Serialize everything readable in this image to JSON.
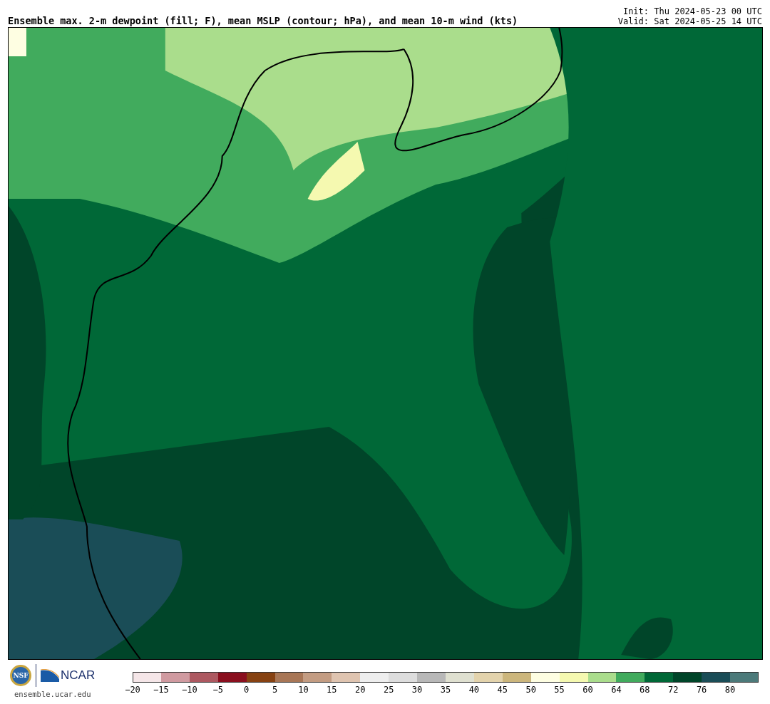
{
  "title": "Ensemble max. 2-m dewpoint (fill; F), mean MSLP (contour; hPa), and mean 10-m wind (kts)",
  "init": "Init: Thu 2024-05-23 00 UTC",
  "valid": "Valid: Sat 2024-05-25 14 UTC",
  "logos": {
    "nsf": "NSF",
    "ncar": "NCAR",
    "site": "ensemble.ucar.edu"
  },
  "colorbar": [
    {
      "label": "−20",
      "color": "#f5e6e8"
    },
    {
      "label": "−15",
      "color": "#d09aa0"
    },
    {
      "label": "−10",
      "color": "#ad5860"
    },
    {
      "label": "−5",
      "color": "#8a0f1e"
    },
    {
      "label": "0",
      "color": "#874212"
    },
    {
      "label": "5",
      "color": "#a87656"
    },
    {
      "label": "10",
      "color": "#c39c82"
    },
    {
      "label": "15",
      "color": "#dfc4b0"
    },
    {
      "label": "20",
      "color": "#eeeeee"
    },
    {
      "label": "25",
      "color": "#dddddd"
    },
    {
      "label": "30",
      "color": "#b8b8b8"
    },
    {
      "label": "35",
      "color": "#dfe0d0"
    },
    {
      "label": "40",
      "color": "#e3d3ac"
    },
    {
      "label": "45",
      "color": "#ccb67c"
    },
    {
      "label": "50",
      "color": "#fefee2"
    },
    {
      "label": "55",
      "color": "#f5f9b0"
    },
    {
      "label": "60",
      "color": "#aadd8c"
    },
    {
      "label": "64",
      "color": "#41ab5d"
    },
    {
      "label": "68",
      "color": "#006837"
    },
    {
      "label": "72",
      "color": "#004529"
    },
    {
      "label": "76",
      "color": "#1a4d57"
    },
    {
      "label": "80",
      "color": "#4c7a7a"
    }
  ]
}
